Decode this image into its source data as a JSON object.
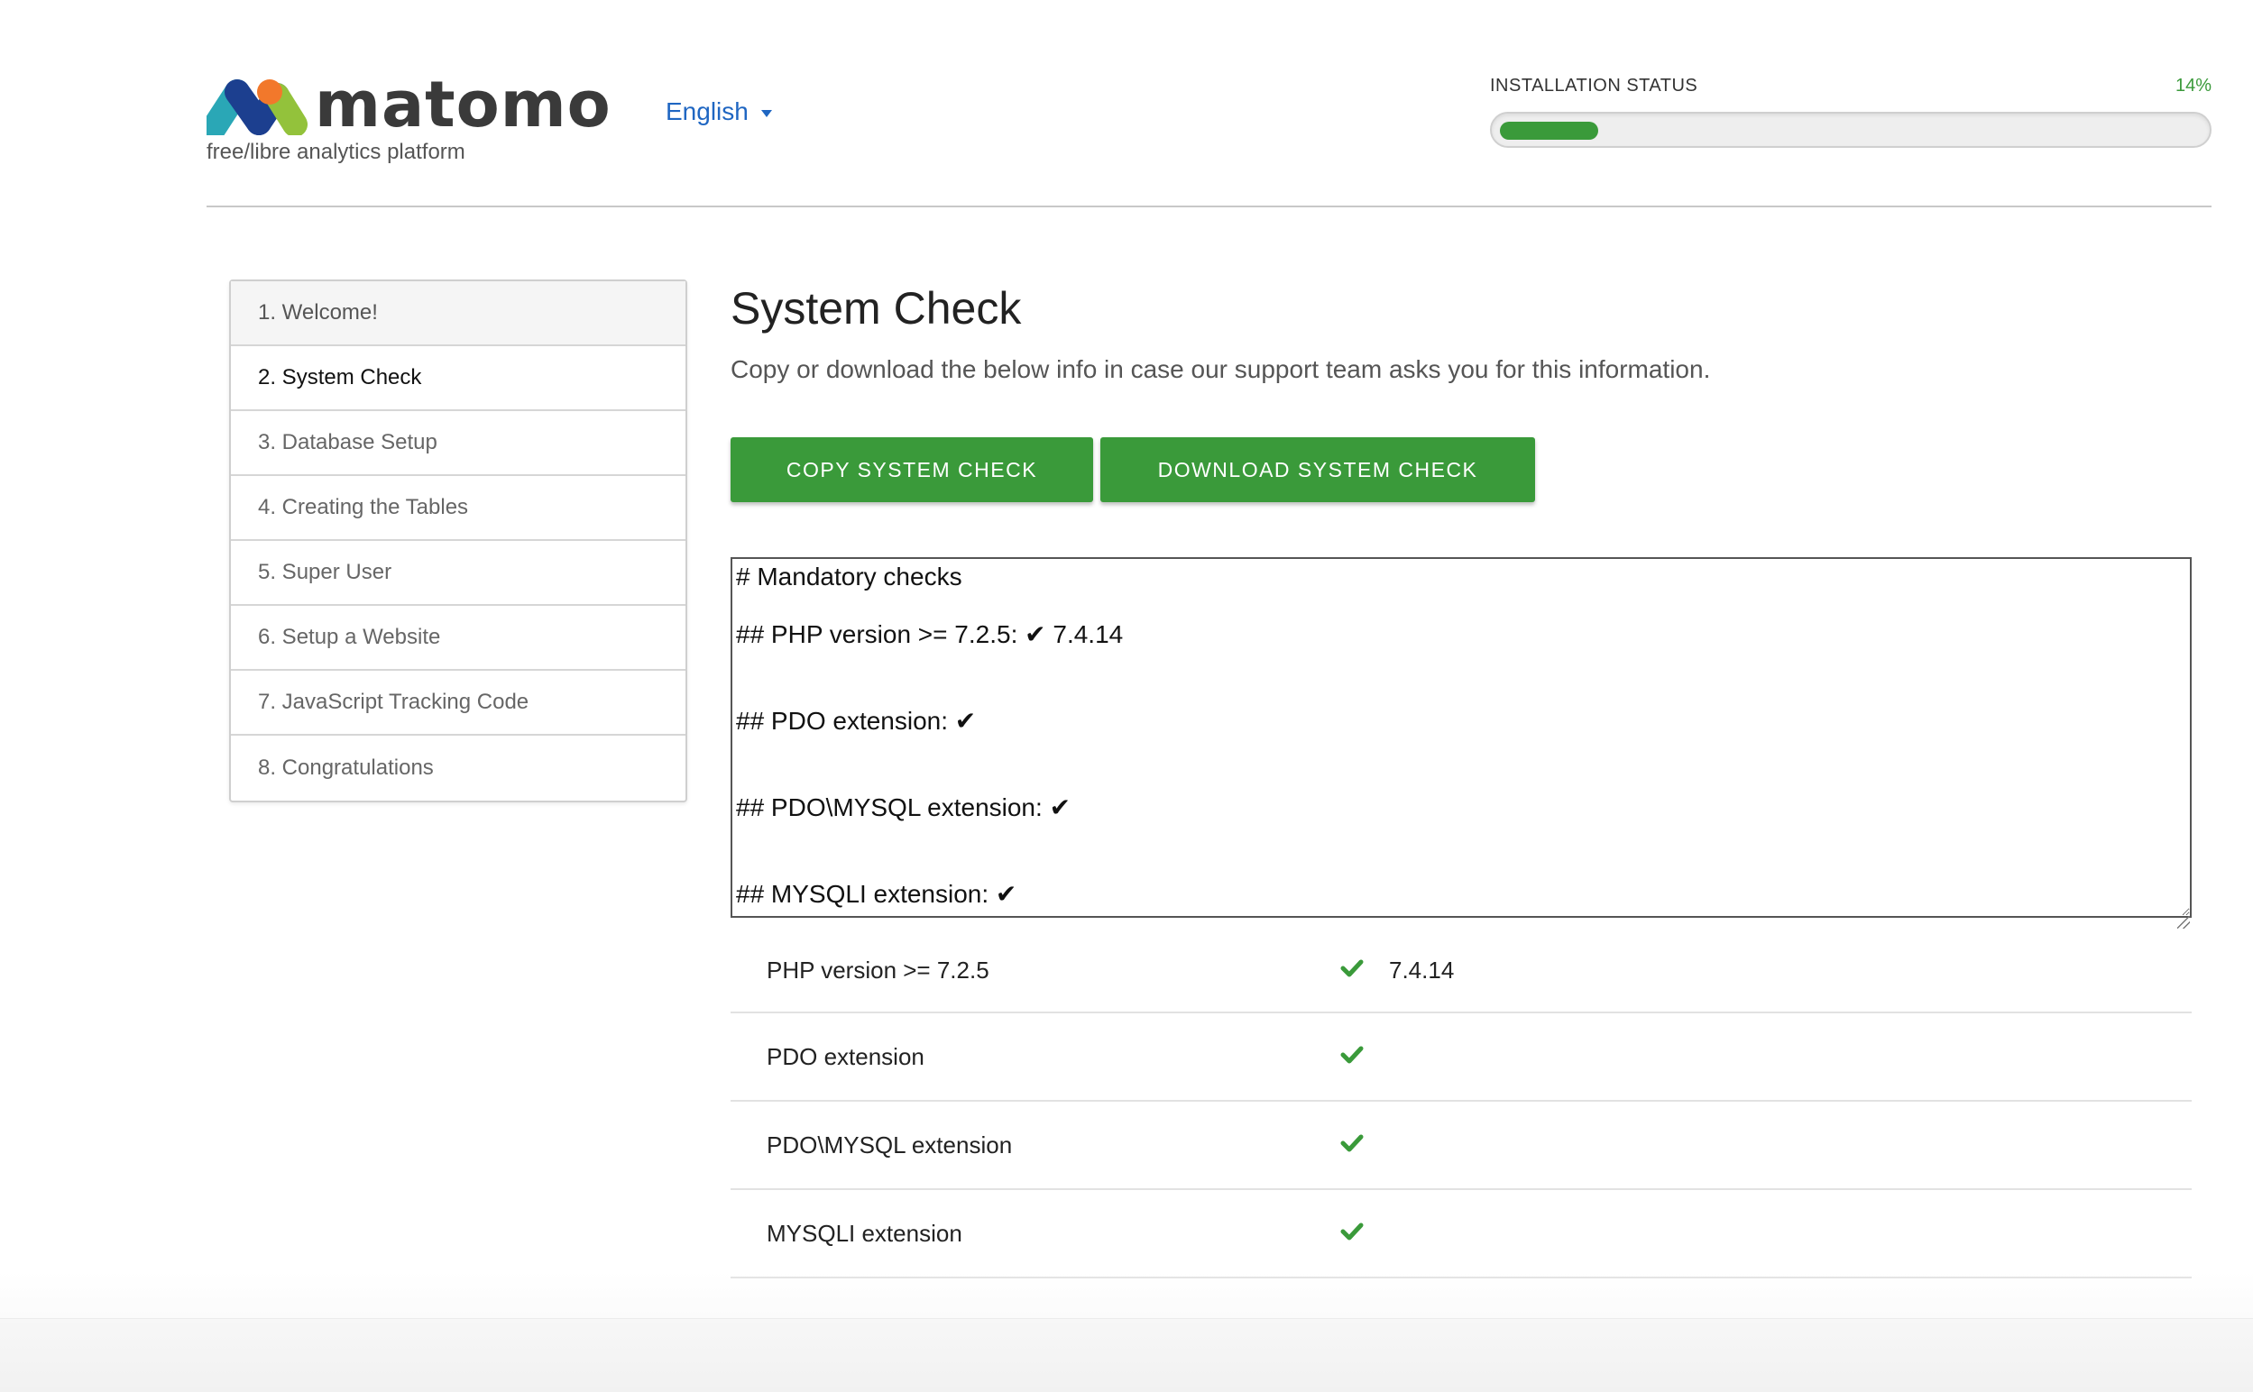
{
  "header": {
    "logo_text": "matomo",
    "tagline": "free/libre analytics platform",
    "language": "English",
    "install_status_label": "INSTALLATION STATUS",
    "install_percent_text": "14%",
    "install_progress": 0.14
  },
  "sidebar": {
    "items": [
      {
        "label": "1. Welcome!",
        "state": "done"
      },
      {
        "label": "2. System Check",
        "state": "active"
      },
      {
        "label": "3. Database Setup",
        "state": "todo"
      },
      {
        "label": "4. Creating the Tables",
        "state": "todo"
      },
      {
        "label": "5. Super User",
        "state": "todo"
      },
      {
        "label": "6. Setup a Website",
        "state": "todo"
      },
      {
        "label": "7. JavaScript Tracking Code",
        "state": "todo"
      },
      {
        "label": "8. Congratulations",
        "state": "todo"
      }
    ]
  },
  "main": {
    "title": "System Check",
    "subtitle": "Copy or download the below info in case our support team asks you for this information.",
    "copy_button": "COPY SYSTEM CHECK",
    "download_button": "DOWNLOAD SYSTEM CHECK",
    "textarea_value": "# Mandatory checks\n\n## PHP version >= 7.2.5: ✔ 7.4.14\n\n\n## PDO extension: ✔\n\n\n## PDO\\MYSQL extension: ✔\n\n\n## MYSQLI extension: ✔"
  },
  "checks": [
    {
      "name": "PHP version >= 7.2.5",
      "status": "ok",
      "value": "7.4.14"
    },
    {
      "name": "PDO extension",
      "status": "ok",
      "value": ""
    },
    {
      "name": "PDO\\MYSQL extension",
      "status": "ok",
      "value": ""
    },
    {
      "name": "MYSQLI extension",
      "status": "ok",
      "value": ""
    }
  ],
  "colors": {
    "accent_green": "#3a9a3a",
    "link_blue": "#1f66c2"
  }
}
